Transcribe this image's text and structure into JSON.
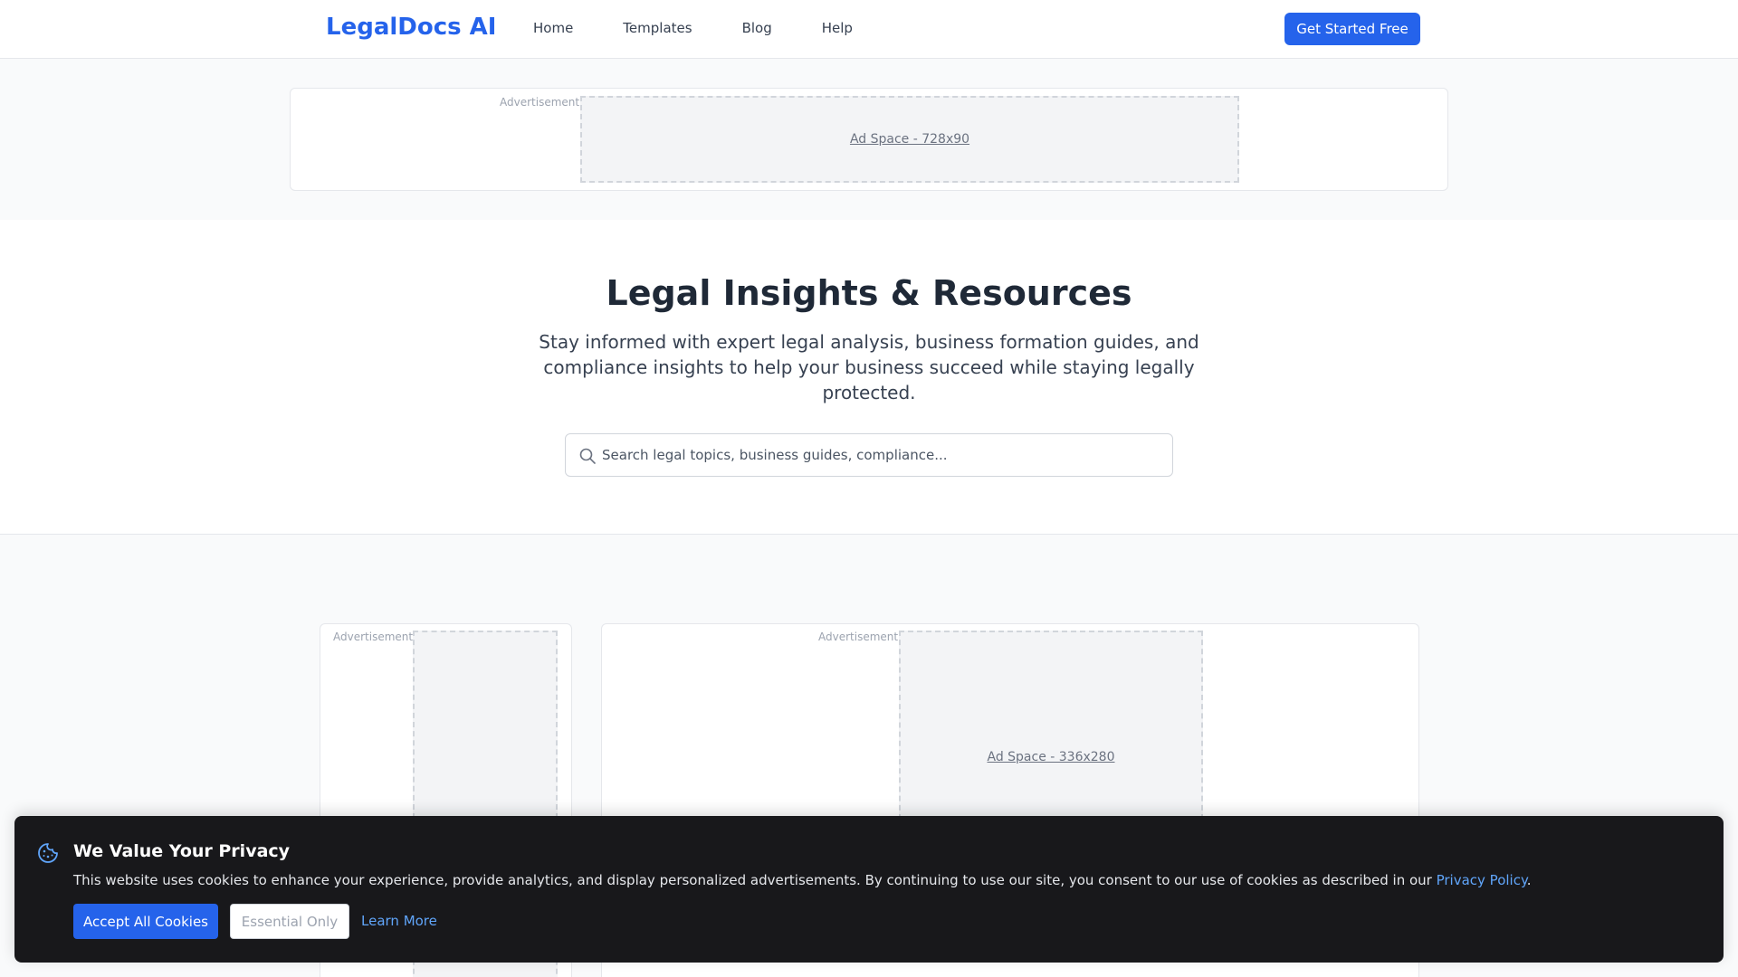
{
  "header": {
    "logo": "LegalDocs AI",
    "nav": [
      "Home",
      "Templates",
      "Blog",
      "Help"
    ],
    "cta_label": "Get Started Free"
  },
  "ads": {
    "label": "Advertisement",
    "top_space": "Ad Space - 728x90",
    "main_space": "Ad Space - 336x280"
  },
  "hero": {
    "title": "Legal Insights & Resources",
    "subtitle": "Stay informed with expert legal analysis, business formation guides, and compliance insights to help your business succeed while staying legally protected.",
    "search_placeholder": "Search legal topics, business guides, compliance..."
  },
  "cookie_banner": {
    "title": "We Value Your Privacy",
    "text": "This website uses cookies to enhance your experience, provide analytics, and display personalized advertisements. By continuing to use our site, you consent to our use of cookies as described in our ",
    "policy_link": "Privacy Policy",
    "text_end": ".",
    "accept_label": "Accept All Cookies",
    "essential_label": "Essential Only",
    "learn_more_label": "Learn More"
  },
  "colors": {
    "brand": "#2563eb",
    "banner_bg": "#18181b",
    "link": "#60a5fa"
  },
  "icons": {
    "search": "search-icon",
    "cookie": "cookie-icon"
  }
}
